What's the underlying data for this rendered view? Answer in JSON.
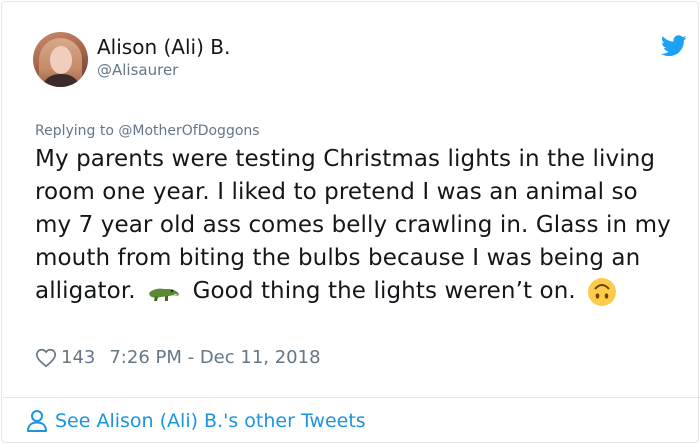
{
  "author": {
    "name": "Alison (Ali) B.",
    "handle": "@Alisaurer"
  },
  "reply": {
    "prefix": "Replying to ",
    "mention": "@MotherOfDoggons"
  },
  "tweet": {
    "text_part1": "My parents were testing Christmas lights in the living room one year. I liked to pretend I was an animal so my 7 year old ass comes belly crawling in. Glass in my mouth from biting the bulbs because I was being an alligator.",
    "text_part2": "Good thing the lights weren’t on.",
    "emoji1": "crocodile-emoji",
    "emoji2": "upside-down-face-emoji"
  },
  "meta": {
    "likes": "143",
    "timestamp": "7:26 PM - Dec 11, 2018"
  },
  "footer": {
    "link_label": "See Alison (Ali) B.'s other Tweets"
  },
  "colors": {
    "twitter_blue": "#1da1f2",
    "link_blue": "#1b95e0",
    "secondary_text": "#657786",
    "primary_text": "#14171a"
  }
}
